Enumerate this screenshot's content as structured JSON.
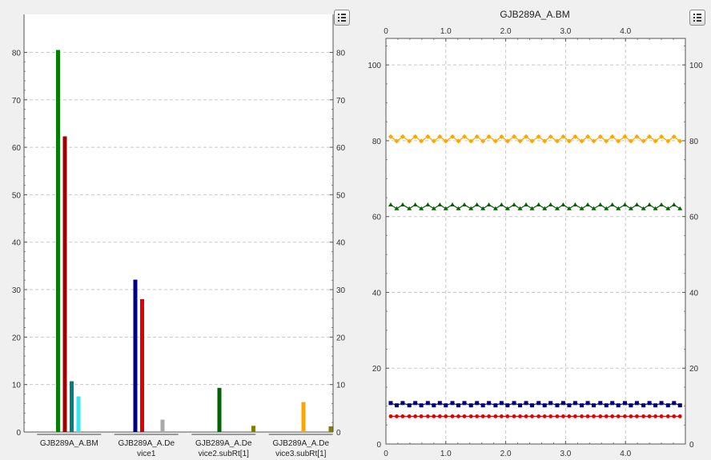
{
  "charts": {
    "left": {
      "chart_data": {
        "type": "bar",
        "categories": [
          "GJB289A_A.BM",
          "GJB289A_A.Device1",
          "GJB289A_A.Device2.subRt[1]",
          "GJB289A_A.Device3.subRt[1]"
        ],
        "category_label_lines": [
          [
            "GJB289A_A.BM"
          ],
          [
            "GJB289A_A.De",
            "vice1"
          ],
          [
            "GJB289A_A.De",
            "vice2.subRt[1]"
          ],
          [
            "GJB289A_A.De",
            "vice3.subRt[1]"
          ]
        ],
        "bars": [
          {
            "category": 0,
            "offset": 0,
            "value": 80.5,
            "color": "#008000"
          },
          {
            "category": 0,
            "offset": 1,
            "value": 62.3,
            "color": "#a00000"
          },
          {
            "category": 0,
            "offset": 2,
            "value": 10.7,
            "color": "#008080"
          },
          {
            "category": 0,
            "offset": 3,
            "value": 7.5,
            "color": "#33e6f0"
          },
          {
            "category": 1,
            "offset": 0,
            "value": 32.1,
            "color": "#00007f"
          },
          {
            "category": 1,
            "offset": 1,
            "value": 28.0,
            "color": "#e00000"
          },
          {
            "category": 1,
            "offset": 4,
            "value": 2.6,
            "color": "#a9a9a9"
          },
          {
            "category": 2,
            "offset": 1,
            "value": 9.3,
            "color": "#006400"
          },
          {
            "category": 2,
            "offset": 6,
            "value": 1.3,
            "color": "#808000"
          },
          {
            "category": 3,
            "offset": 2,
            "value": 6.3,
            "color": "#ffa500"
          },
          {
            "category": 3,
            "offset": 6,
            "value": 1.2,
            "color": "#808000"
          }
        ],
        "ylim": [
          0,
          88
        ],
        "yticks": [
          0,
          10,
          20,
          30,
          40,
          50,
          60,
          70,
          80
        ],
        "grid": true
      }
    },
    "right": {
      "chart_data": {
        "type": "line",
        "title": "GJB289A_A.BM",
        "xlim": [
          0,
          5.0
        ],
        "ylim": [
          0,
          107
        ],
        "xticks": [
          0,
          1.0,
          2.0,
          3.0,
          4.0
        ],
        "xtick_labels": [
          "0",
          "1.0",
          "2.0",
          "3.0",
          "4.0"
        ],
        "yticks": [
          0,
          20,
          40,
          60,
          80,
          100
        ],
        "grid": true,
        "series": [
          {
            "color": "#ffa500",
            "marker": "diamond",
            "base": 80.5,
            "amplitude": 0.6,
            "x": [
              0.08,
              0.18,
              0.28,
              0.39,
              0.49,
              0.59,
              0.7,
              0.8,
              0.9,
              1.0,
              1.11,
              1.21,
              1.31,
              1.42,
              1.52,
              1.62,
              1.72,
              1.83,
              1.93,
              2.03,
              2.14,
              2.24,
              2.34,
              2.44,
              2.55,
              2.65,
              2.75,
              2.86,
              2.96,
              3.06,
              3.16,
              3.27,
              3.37,
              3.47,
              3.58,
              3.68,
              3.78,
              3.88,
              3.99,
              4.09,
              4.19,
              4.3,
              4.4,
              4.5,
              4.6,
              4.71,
              4.81,
              4.91
            ]
          },
          {
            "color": "#006400",
            "marker": "triangle",
            "base": 62.6,
            "amplitude": 0.5,
            "x": [
              0.08,
              0.18,
              0.28,
              0.39,
              0.49,
              0.59,
              0.7,
              0.8,
              0.9,
              1.0,
              1.11,
              1.21,
              1.31,
              1.42,
              1.52,
              1.62,
              1.72,
              1.83,
              1.93,
              2.03,
              2.14,
              2.24,
              2.34,
              2.44,
              2.55,
              2.65,
              2.75,
              2.86,
              2.96,
              3.06,
              3.16,
              3.27,
              3.37,
              3.47,
              3.58,
              3.68,
              3.78,
              3.88,
              3.99,
              4.09,
              4.19,
              4.3,
              4.4,
              4.5,
              4.6,
              4.71,
              4.81,
              4.91
            ]
          },
          {
            "color": "#00007f",
            "marker": "square",
            "base": 10.5,
            "amplitude": 0.3,
            "x": [
              0.08,
              0.18,
              0.28,
              0.39,
              0.49,
              0.59,
              0.7,
              0.8,
              0.9,
              1.0,
              1.11,
              1.21,
              1.31,
              1.42,
              1.52,
              1.62,
              1.72,
              1.83,
              1.93,
              2.03,
              2.14,
              2.24,
              2.34,
              2.44,
              2.55,
              2.65,
              2.75,
              2.86,
              2.96,
              3.06,
              3.16,
              3.27,
              3.37,
              3.47,
              3.58,
              3.68,
              3.78,
              3.88,
              3.99,
              4.09,
              4.19,
              4.3,
              4.4,
              4.5,
              4.6,
              4.71,
              4.81,
              4.91
            ]
          },
          {
            "color": "#e00000",
            "marker": "circle",
            "base": 7.3,
            "amplitude": 0,
            "x": [
              0.08,
              0.18,
              0.28,
              0.39,
              0.49,
              0.59,
              0.7,
              0.8,
              0.9,
              1.0,
              1.11,
              1.21,
              1.31,
              1.42,
              1.52,
              1.62,
              1.72,
              1.83,
              1.93,
              2.03,
              2.14,
              2.24,
              2.34,
              2.44,
              2.55,
              2.65,
              2.75,
              2.86,
              2.96,
              3.06,
              3.16,
              3.27,
              3.37,
              3.47,
              3.58,
              3.68,
              3.78,
              3.88,
              3.99,
              4.09,
              4.19,
              4.3,
              4.4,
              4.5,
              4.6,
              4.71,
              4.81,
              4.91
            ]
          }
        ]
      }
    }
  },
  "icons": {
    "left_menu": "list-icon",
    "right_menu": "list-icon"
  }
}
